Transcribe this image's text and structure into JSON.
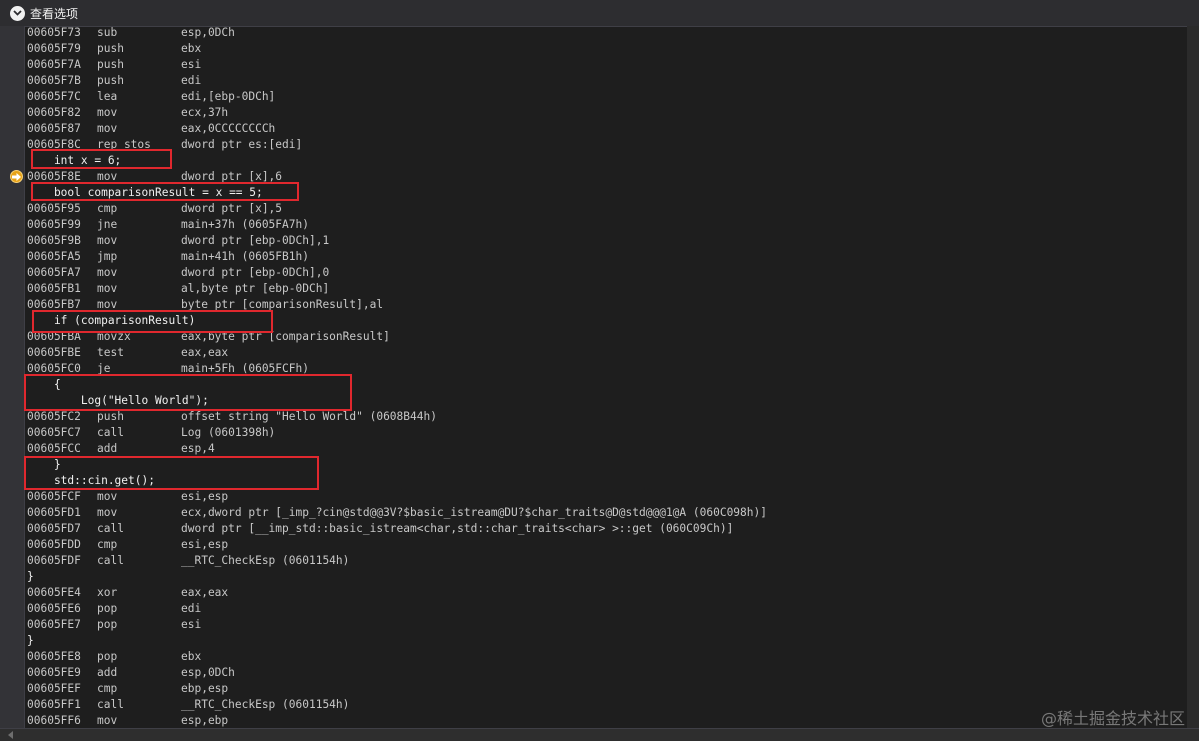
{
  "toolbar": {
    "view_options_label": "查看选项"
  },
  "lines": [
    {
      "type": "asm",
      "addr": "00605F73",
      "op": "sub",
      "arg": "esp,0DCh"
    },
    {
      "type": "asm",
      "addr": "00605F79",
      "op": "push",
      "arg": "ebx"
    },
    {
      "type": "asm",
      "addr": "00605F7A",
      "op": "push",
      "arg": "esi"
    },
    {
      "type": "asm",
      "addr": "00605F7B",
      "op": "push",
      "arg": "edi"
    },
    {
      "type": "asm",
      "addr": "00605F7C",
      "op": "lea",
      "arg": "edi,[ebp-0DCh]"
    },
    {
      "type": "asm",
      "addr": "00605F82",
      "op": "mov",
      "arg": "ecx,37h"
    },
    {
      "type": "asm",
      "addr": "00605F87",
      "op": "mov",
      "arg": "eax,0CCCCCCCCh"
    },
    {
      "type": "asm",
      "addr": "00605F8C",
      "op": "rep stos",
      "arg": "dword ptr es:[edi]"
    },
    {
      "type": "src",
      "text": "    int x = 6;"
    },
    {
      "type": "asm",
      "addr": "00605F8E",
      "op": "mov",
      "arg": "dword ptr [x],6"
    },
    {
      "type": "src",
      "text": "    bool comparisonResult = x == 5;"
    },
    {
      "type": "asm",
      "addr": "00605F95",
      "op": "cmp",
      "arg": "dword ptr [x],5"
    },
    {
      "type": "asm",
      "addr": "00605F99",
      "op": "jne",
      "arg": "main+37h (0605FA7h)"
    },
    {
      "type": "asm",
      "addr": "00605F9B",
      "op": "mov",
      "arg": "dword ptr [ebp-0DCh],1"
    },
    {
      "type": "asm",
      "addr": "00605FA5",
      "op": "jmp",
      "arg": "main+41h (0605FB1h)"
    },
    {
      "type": "asm",
      "addr": "00605FA7",
      "op": "mov",
      "arg": "dword ptr [ebp-0DCh],0"
    },
    {
      "type": "asm",
      "addr": "00605FB1",
      "op": "mov",
      "arg": "al,byte ptr [ebp-0DCh]"
    },
    {
      "type": "asm",
      "addr": "00605FB7",
      "op": "mov",
      "arg": "byte ptr [comparisonResult],al"
    },
    {
      "type": "src",
      "text": "    if (comparisonResult)"
    },
    {
      "type": "asm",
      "addr": "00605FBA",
      "op": "movzx",
      "arg": "eax,byte ptr [comparisonResult]"
    },
    {
      "type": "asm",
      "addr": "00605FBE",
      "op": "test",
      "arg": "eax,eax"
    },
    {
      "type": "asm",
      "addr": "00605FC0",
      "op": "je",
      "arg": "main+5Fh (0605FCFh)"
    },
    {
      "type": "src",
      "text": "    {"
    },
    {
      "type": "src",
      "text": "        Log(\"Hello World\");"
    },
    {
      "type": "asm",
      "addr": "00605FC2",
      "op": "push",
      "arg": "offset string \"Hello World\" (0608B44h)"
    },
    {
      "type": "asm",
      "addr": "00605FC7",
      "op": "call",
      "arg": "Log (0601398h)"
    },
    {
      "type": "asm",
      "addr": "00605FCC",
      "op": "add",
      "arg": "esp,4"
    },
    {
      "type": "src",
      "text": "    }"
    },
    {
      "type": "src",
      "text": "    std::cin.get();"
    },
    {
      "type": "asm",
      "addr": "00605FCF",
      "op": "mov",
      "arg": "esi,esp"
    },
    {
      "type": "asm",
      "addr": "00605FD1",
      "op": "mov",
      "arg": "ecx,dword ptr [_imp_?cin@std@@3V?$basic_istream@DU?$char_traits@D@std@@@1@A (060C098h)]"
    },
    {
      "type": "asm",
      "addr": "00605FD7",
      "op": "call",
      "arg": "dword ptr [__imp_std::basic_istream<char,std::char_traits<char> >::get (060C09Ch)]"
    },
    {
      "type": "asm",
      "addr": "00605FDD",
      "op": "cmp",
      "arg": "esi,esp"
    },
    {
      "type": "asm",
      "addr": "00605FDF",
      "op": "call",
      "arg": "__RTC_CheckEsp (0601154h)"
    },
    {
      "type": "src",
      "text": "}"
    },
    {
      "type": "asm",
      "addr": "00605FE4",
      "op": "xor",
      "arg": "eax,eax"
    },
    {
      "type": "asm",
      "addr": "00605FE6",
      "op": "pop",
      "arg": "edi"
    },
    {
      "type": "asm",
      "addr": "00605FE7",
      "op": "pop",
      "arg": "esi"
    },
    {
      "type": "src",
      "text": "}"
    },
    {
      "type": "asm",
      "addr": "00605FE8",
      "op": "pop",
      "arg": "ebx"
    },
    {
      "type": "asm",
      "addr": "00605FE9",
      "op": "add",
      "arg": "esp,0DCh"
    },
    {
      "type": "asm",
      "addr": "00605FEF",
      "op": "cmp",
      "arg": "ebp,esp"
    },
    {
      "type": "asm",
      "addr": "00605FF1",
      "op": "call",
      "arg": "__RTC_CheckEsp (0601154h)"
    },
    {
      "type": "asm",
      "addr": "00605FF6",
      "op": "mov",
      "arg": "esp,ebp"
    }
  ],
  "current_instruction_address": "00605F8E",
  "colors": {
    "highlight_box": "#e0282e",
    "breakpoint_arrow": "#e8a317",
    "background": "#1e1e1e"
  },
  "watermark": "@稀土掘金技术社区"
}
